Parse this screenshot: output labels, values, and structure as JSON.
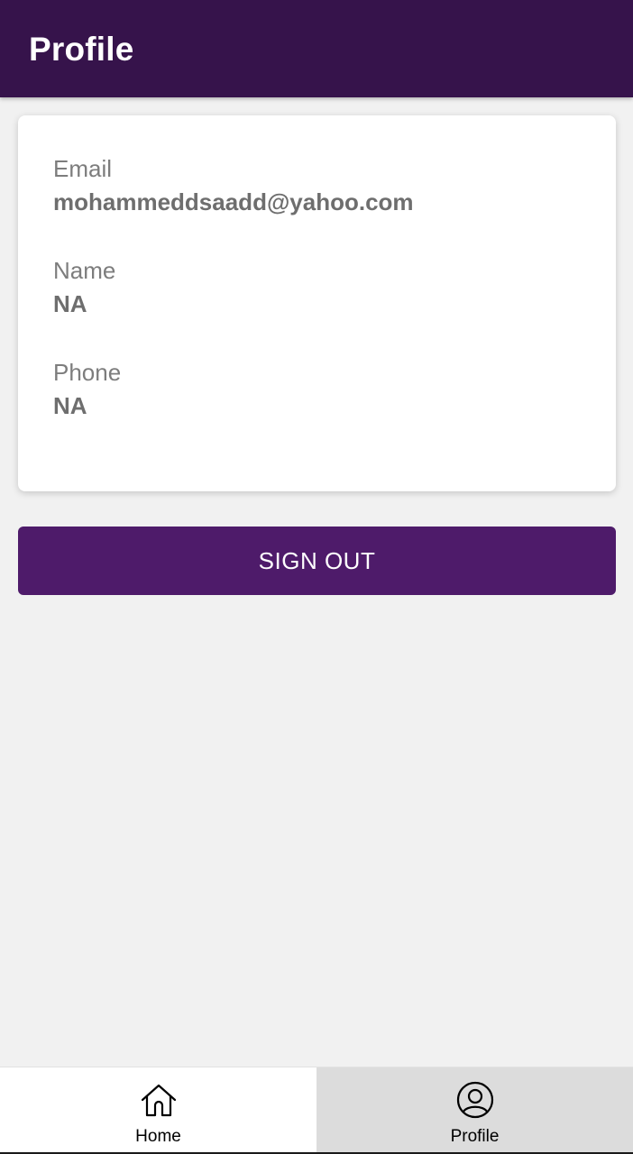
{
  "app_bar": {
    "title": "Profile"
  },
  "profile_card": {
    "email": {
      "label": "Email",
      "value": "mohammeddsaadd@yahoo.com"
    },
    "name": {
      "label": "Name",
      "value": "NA"
    },
    "phone": {
      "label": "Phone",
      "value": "NA"
    }
  },
  "actions": {
    "sign_out_label": "SIGN OUT"
  },
  "bottom_nav": {
    "items": [
      {
        "label": "Home",
        "icon": "home-icon",
        "selected": false
      },
      {
        "label": "Profile",
        "icon": "user-circle-icon",
        "selected": true
      }
    ]
  },
  "colors": {
    "app_bar": "#36134b",
    "button": "#4e1b6a",
    "background": "#f1f1f1",
    "selected_tab": "#dcdcdc"
  }
}
